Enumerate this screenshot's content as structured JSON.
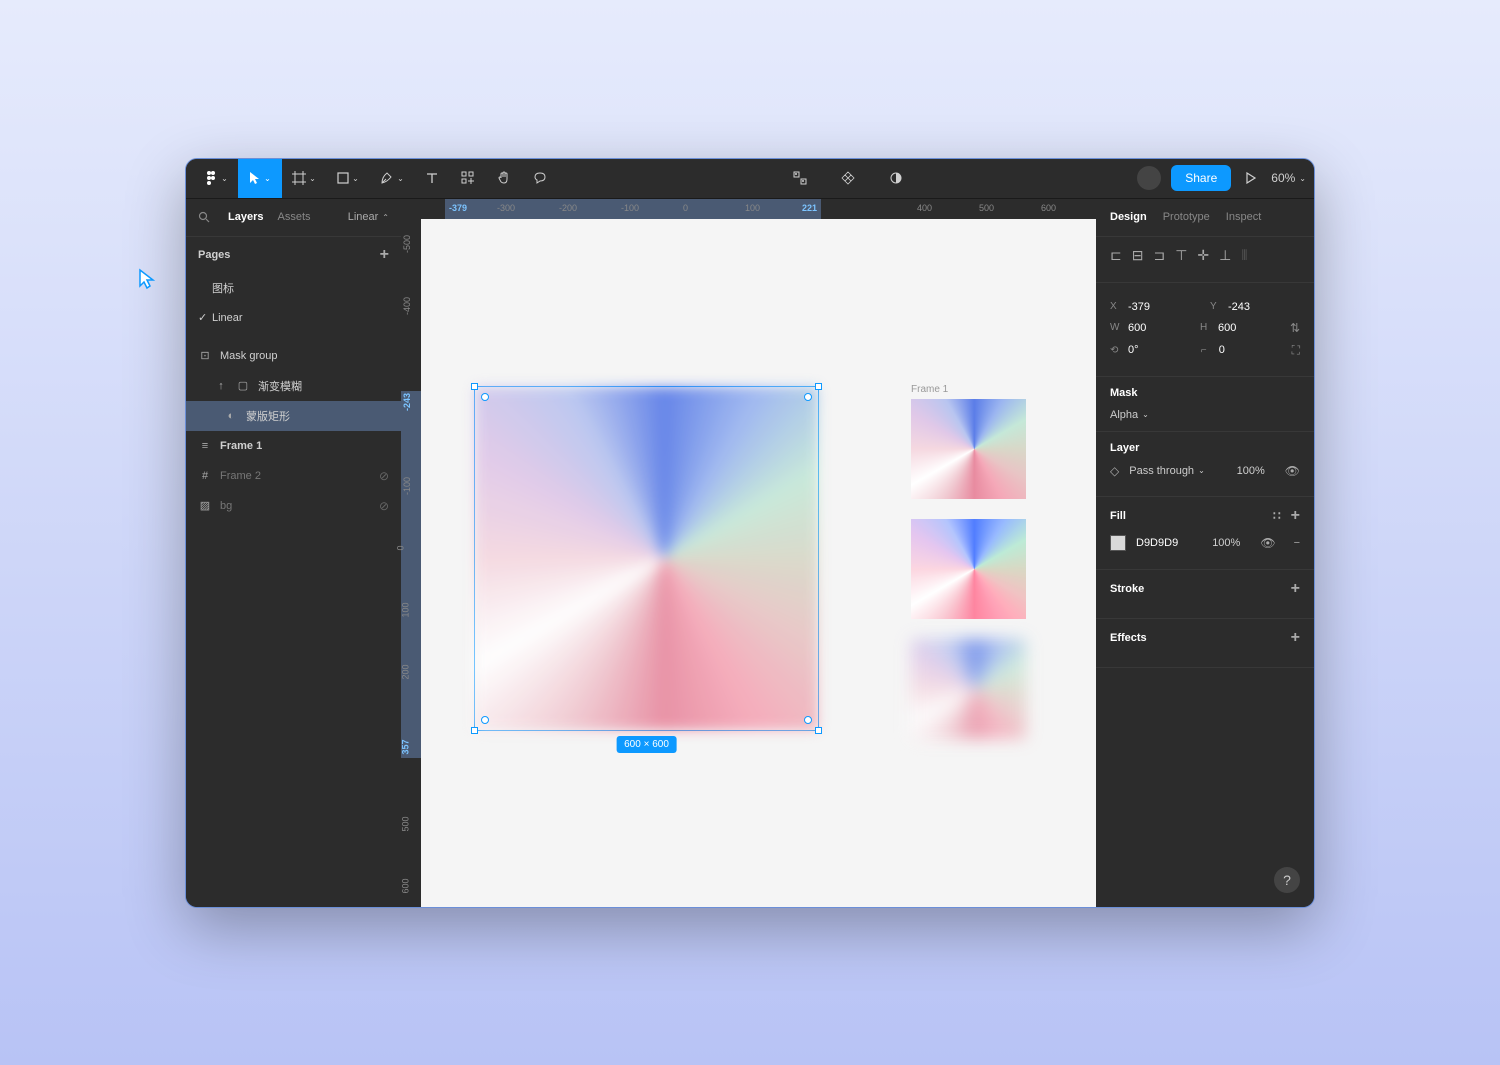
{
  "toolbar": {
    "share_label": "Share",
    "zoom": "60%"
  },
  "left_panel": {
    "tab_layers": "Layers",
    "tab_assets": "Assets",
    "filter": "Linear",
    "pages_header": "Pages",
    "pages": [
      "图标",
      "Linear"
    ],
    "layers": {
      "mask_group": "Mask group",
      "gradient_blur": "渐变模糊",
      "mask_rect": "蒙版矩形",
      "frame1": "Frame 1",
      "frame2": "Frame 2",
      "bg": "bg"
    }
  },
  "canvas": {
    "ruler_top": [
      "-379",
      "-300",
      "-200",
      "-100",
      "0",
      "100",
      "221",
      "400",
      "500",
      "600"
    ],
    "ruler_left": [
      "-500",
      "-400",
      "-243",
      "-100",
      "0",
      "100",
      "200",
      "357",
      "500",
      "600"
    ],
    "dim_label": "600 × 600",
    "thumb_label": "Frame 1"
  },
  "right_panel": {
    "tab_design": "Design",
    "tab_prototype": "Prototype",
    "tab_inspect": "Inspect",
    "x": "-379",
    "y": "-243",
    "w": "600",
    "h": "600",
    "rotation": "0°",
    "corner": "0",
    "mask_title": "Mask",
    "mask_mode": "Alpha",
    "layer_title": "Layer",
    "blend_mode": "Pass through",
    "layer_opacity": "100%",
    "fill_title": "Fill",
    "fill_hex": "D9D9D9",
    "fill_opacity": "100%",
    "stroke_title": "Stroke",
    "effects_title": "Effects"
  }
}
